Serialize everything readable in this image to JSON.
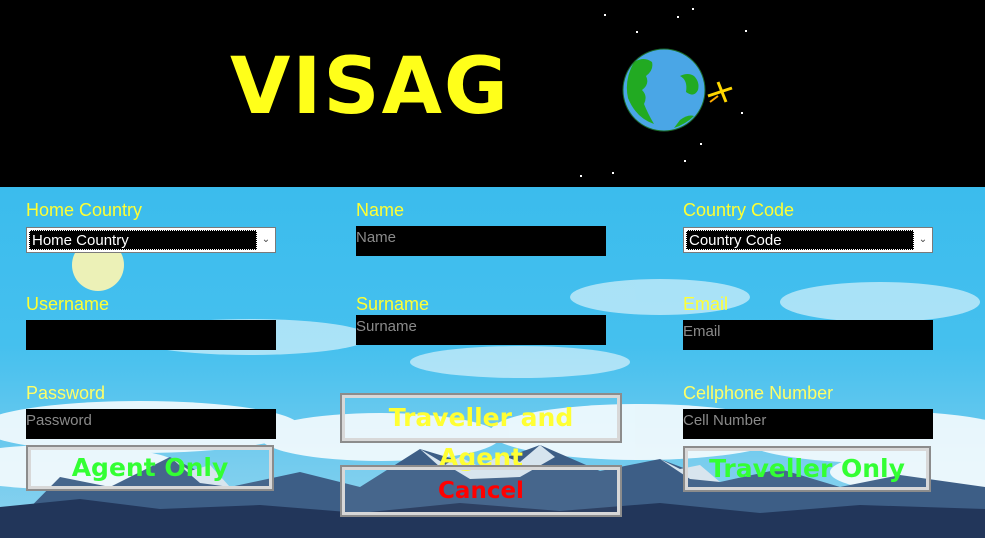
{
  "app": {
    "title": "VISAG"
  },
  "form": {
    "home_country": {
      "label": "Home Country",
      "selected": "Home Country"
    },
    "name": {
      "label": "Name",
      "placeholder": "Name"
    },
    "country_code": {
      "label": "Country Code",
      "selected": "Country Code"
    },
    "username": {
      "label": "Username",
      "placeholder": ""
    },
    "surname": {
      "label": "Surname",
      "placeholder": "Surname"
    },
    "email": {
      "label": "Email",
      "placeholder": "Email"
    },
    "password": {
      "label": "Password",
      "placeholder": "Password"
    },
    "cellphone": {
      "label": "Cellphone Number",
      "placeholder": "Cell Number"
    }
  },
  "buttons": {
    "traveller_and_agent": "Traveller and Agent",
    "agent_only": "Agent Only",
    "cancel": "Cancel",
    "traveller_only": "Traveller Only"
  },
  "colors": {
    "label": "#ffff33",
    "logo": "#ffff1a",
    "primary_button_text": "#ffff33",
    "role_button_text": "#33ff33",
    "cancel_text": "#ff0000",
    "sky": "#3bbced"
  }
}
